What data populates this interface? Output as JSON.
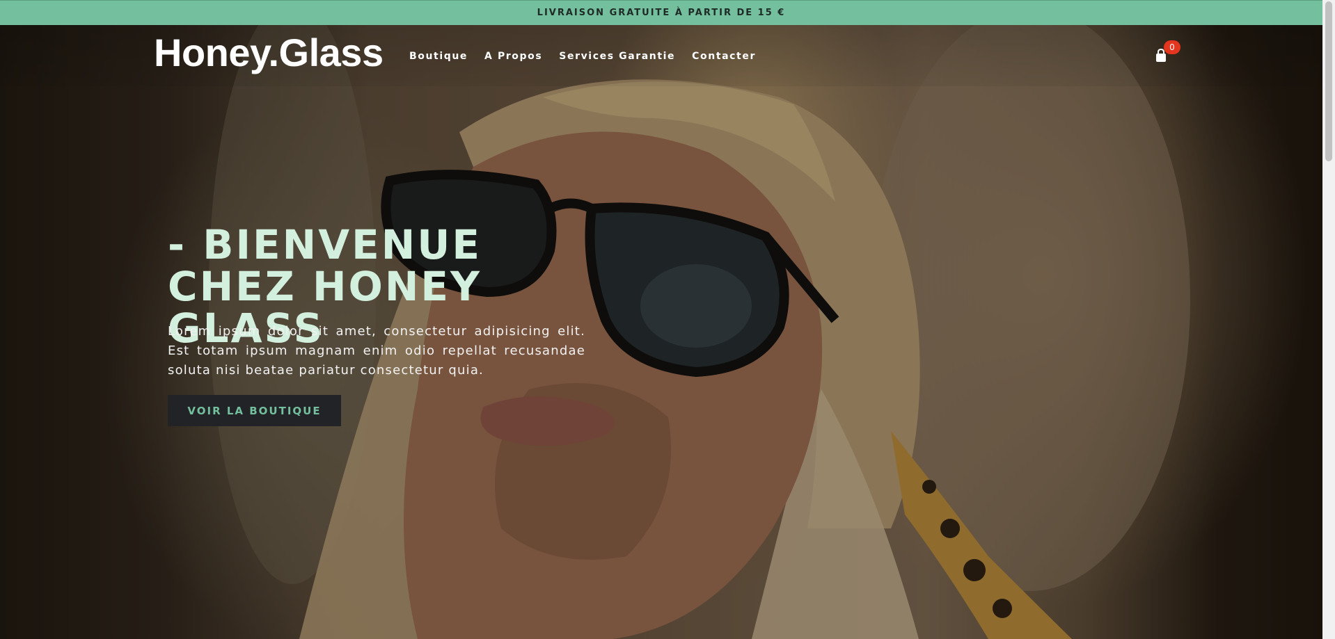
{
  "announcement": "LIVRAISON GRATUITE À PARTIR DE 15 €",
  "brand": "Honey.Glass",
  "nav": [
    {
      "label": "Boutique"
    },
    {
      "label": "A Propos"
    },
    {
      "label": "Services Garantie"
    },
    {
      "label": "Contacter"
    }
  ],
  "cart": {
    "count": "0",
    "icon": "shopping-bag-icon"
  },
  "hero": {
    "title": "- BIENVENUE CHEZ HONEY GLASS",
    "description": "Lorem ipsum dolor sit amet, consectetur adipisicing elit. Est totam ipsum magnam enim odio repellat recusandae soluta nisi beatae pariatur consectetur quia.",
    "cta_label": "VOIR LA BOUTIQUE"
  },
  "colors": {
    "accent": "#74bf9e",
    "title": "#d3efdd",
    "badge": "#e4351f",
    "button": "#222326"
  }
}
